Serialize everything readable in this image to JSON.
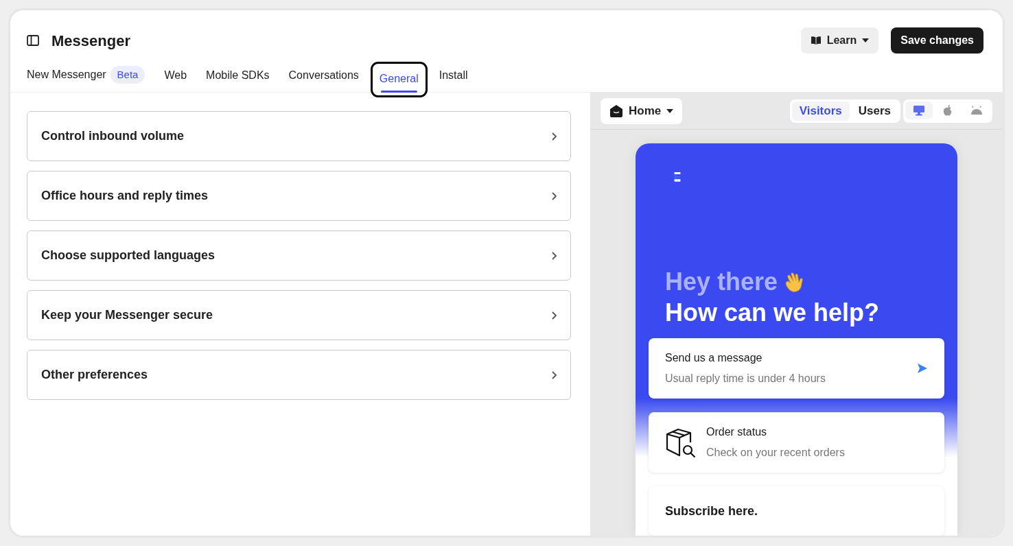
{
  "header": {
    "title": "Messenger",
    "learn_button": "Learn",
    "save_button": "Save changes"
  },
  "tabs": [
    {
      "label": "New Messenger",
      "badge": "Beta",
      "selected": false,
      "highlighted": false
    },
    {
      "label": "Web",
      "selected": false,
      "highlighted": false
    },
    {
      "label": "Mobile SDKs",
      "selected": false,
      "highlighted": false
    },
    {
      "label": "Conversations",
      "selected": false,
      "highlighted": false
    },
    {
      "label": "General",
      "selected": true,
      "highlighted": true
    },
    {
      "label": "Install",
      "selected": false,
      "highlighted": false
    }
  ],
  "settings": [
    {
      "label": "Control inbound volume"
    },
    {
      "label": "Office hours and reply times"
    },
    {
      "label": "Choose supported languages"
    },
    {
      "label": "Keep your Messenger secure"
    },
    {
      "label": "Other preferences"
    }
  ],
  "preview_toolbar": {
    "page_select": "Home",
    "audience": [
      {
        "label": "Visitors",
        "selected": true
      },
      {
        "label": "Users",
        "selected": false
      }
    ],
    "platforms": [
      {
        "kind": "desktop",
        "selected": true
      },
      {
        "kind": "apple",
        "selected": false
      },
      {
        "kind": "android",
        "selected": false
      }
    ]
  },
  "messenger": {
    "greeting": "Hey there",
    "headline": "How can we help?",
    "cards": [
      {
        "kind": "message",
        "title": "Send us a message",
        "subtitle": "Usual reply time is under 4 hours"
      },
      {
        "kind": "order",
        "title": "Order status",
        "subtitle": "Check on your recent orders"
      },
      {
        "kind": "plain",
        "title": "Subscribe here."
      }
    ]
  }
}
